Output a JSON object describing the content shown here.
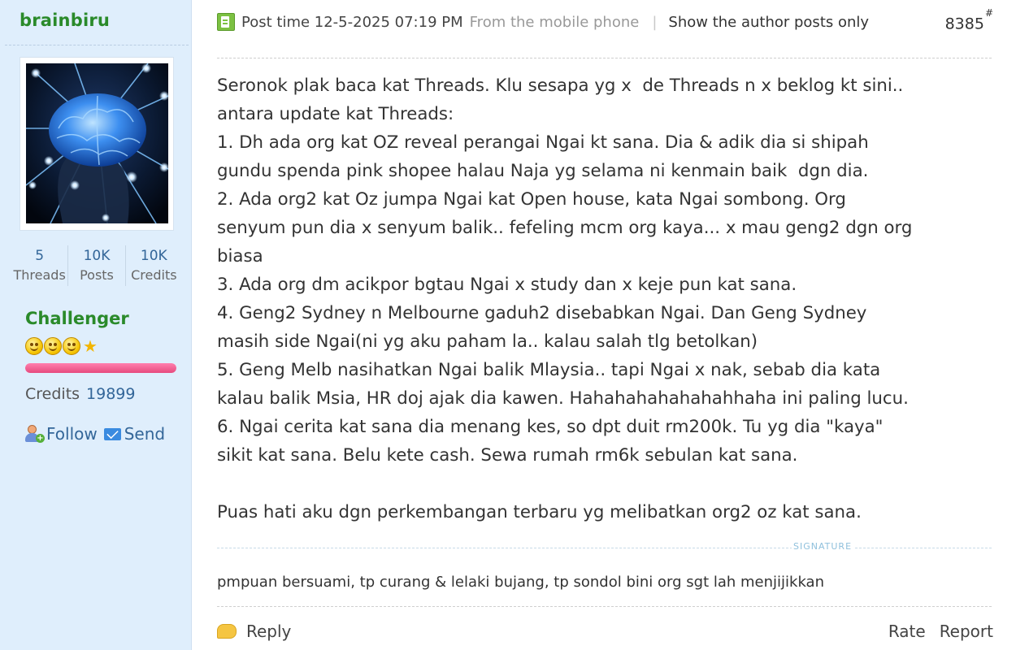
{
  "sidebar": {
    "username": "brainbiru",
    "stats": [
      {
        "value": "5",
        "label": "Threads"
      },
      {
        "value": "10K",
        "label": "Posts"
      },
      {
        "value": "10K",
        "label": "Credits"
      }
    ],
    "usergroup": "Challenger",
    "rank_icons": [
      "smiley-icon",
      "smiley-icon",
      "smiley-icon",
      "star-icon"
    ],
    "level_progress_percent": 100,
    "credits_label": "Credits",
    "credits_value": "19899",
    "follow_label": "Follow",
    "send_label": "Send"
  },
  "post": {
    "time": "Post time 12-5-2025 07:19 PM",
    "source": "From the mobile phone",
    "separator": "|",
    "author_only": "Show the author posts only",
    "floor": "8385",
    "floor_mark": "#",
    "body_lines": [
      "Seronok plak baca kat Threads. Klu sesapa yg x  de Threads n x beklog kt sini..",
      "antara update kat Threads:",
      "1. Dh ada org kat OZ reveal perangai Ngai kt sana. Dia & adik dia si shipah",
      "gundu spenda pink shopee halau Naja yg selama ni kenmain baik  dgn dia.",
      "2. Ada org2 kat Oz jumpa Ngai kat Open house, kata Ngai sombong. Org",
      "senyum pun dia x senyum balik.. fefeling mcm org kaya... x mau geng2 dgn org",
      "biasa",
      "3. Ada org dm acikpor bgtau Ngai x study dan x keje pun kat sana.",
      "4. Geng2 Sydney n Melbourne gaduh2 disebabkan Ngai. Dan Geng Sydney",
      "masih side Ngai(ni yg aku paham la.. kalau salah tlg betolkan)",
      "5. Geng Melb nasihatkan Ngai balik Mlaysia.. tapi Ngai x nak, sebab dia kata",
      "kalau balik Msia, HR doj ajak dia kawen. Hahahahahahahahhaha ini paling lucu.",
      "6. Ngai cerita kat sana dia menang kes, so dpt duit rm200k. Tu yg dia \"kaya\"",
      "sikit kat sana. Belu kete cash. Sewa rumah rm6k sebulan kat sana.",
      "",
      "Puas hati aku dgn perkembangan terbaru yg melibatkan org2 oz kat sana."
    ],
    "signature_label": "SIGNATURE",
    "signature": "pmpuan bersuami, tp curang & lelaki bujang, tp sondol bini org sgt lah menjijikkan"
  },
  "footer": {
    "reply_label": "Reply",
    "rate_label": "Rate",
    "report_label": "Report"
  },
  "colors": {
    "sidebar_bg": "#dfeefc",
    "username": "#2a8a2a",
    "link": "#336699",
    "progress": "#e64a7e"
  }
}
